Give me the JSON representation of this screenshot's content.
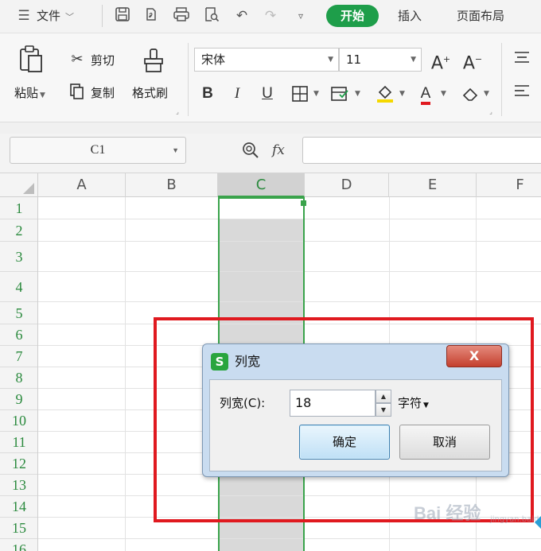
{
  "menubar": {
    "file_label": "文件",
    "tabs": [
      {
        "label": "开始",
        "active": true
      },
      {
        "label": "插入",
        "active": false
      },
      {
        "label": "页面布局",
        "active": false
      }
    ],
    "icons": [
      "menu-icon",
      "save-icon",
      "export-pdf-icon",
      "print-icon",
      "print-preview-icon",
      "undo-icon",
      "redo-icon",
      "customize-icon"
    ]
  },
  "ribbon": {
    "paste_label": "粘贴",
    "cut_label": "剪切",
    "copy_label": "复制",
    "format_painter_label": "格式刷",
    "font_name": "宋体",
    "font_size": "11",
    "font_color": "#e0191f",
    "fill_color": "#f5d800"
  },
  "formula_bar": {
    "cell_ref": "C1",
    "formula": ""
  },
  "grid": {
    "columns": [
      "A",
      "B",
      "C",
      "D",
      "E",
      "F"
    ],
    "selected_column": "C",
    "rows": [
      "1",
      "2",
      "3",
      "4",
      "5",
      "6",
      "7",
      "8",
      "9",
      "10",
      "11",
      "12",
      "13",
      "14",
      "15",
      "16"
    ]
  },
  "dialog": {
    "title": "列宽",
    "close_label": "X",
    "width_label": "列宽(C):",
    "width_value": "18",
    "unit": "字符",
    "ok_label": "确定",
    "cancel_label": "取消"
  },
  "watermark": {
    "text": "Bai 经验",
    "subtext": "jingyan.baidu.com"
  },
  "colors": {
    "accent": "#1e9e4a",
    "selection": "#3aa34b",
    "highlight_box": "#e0191f"
  }
}
